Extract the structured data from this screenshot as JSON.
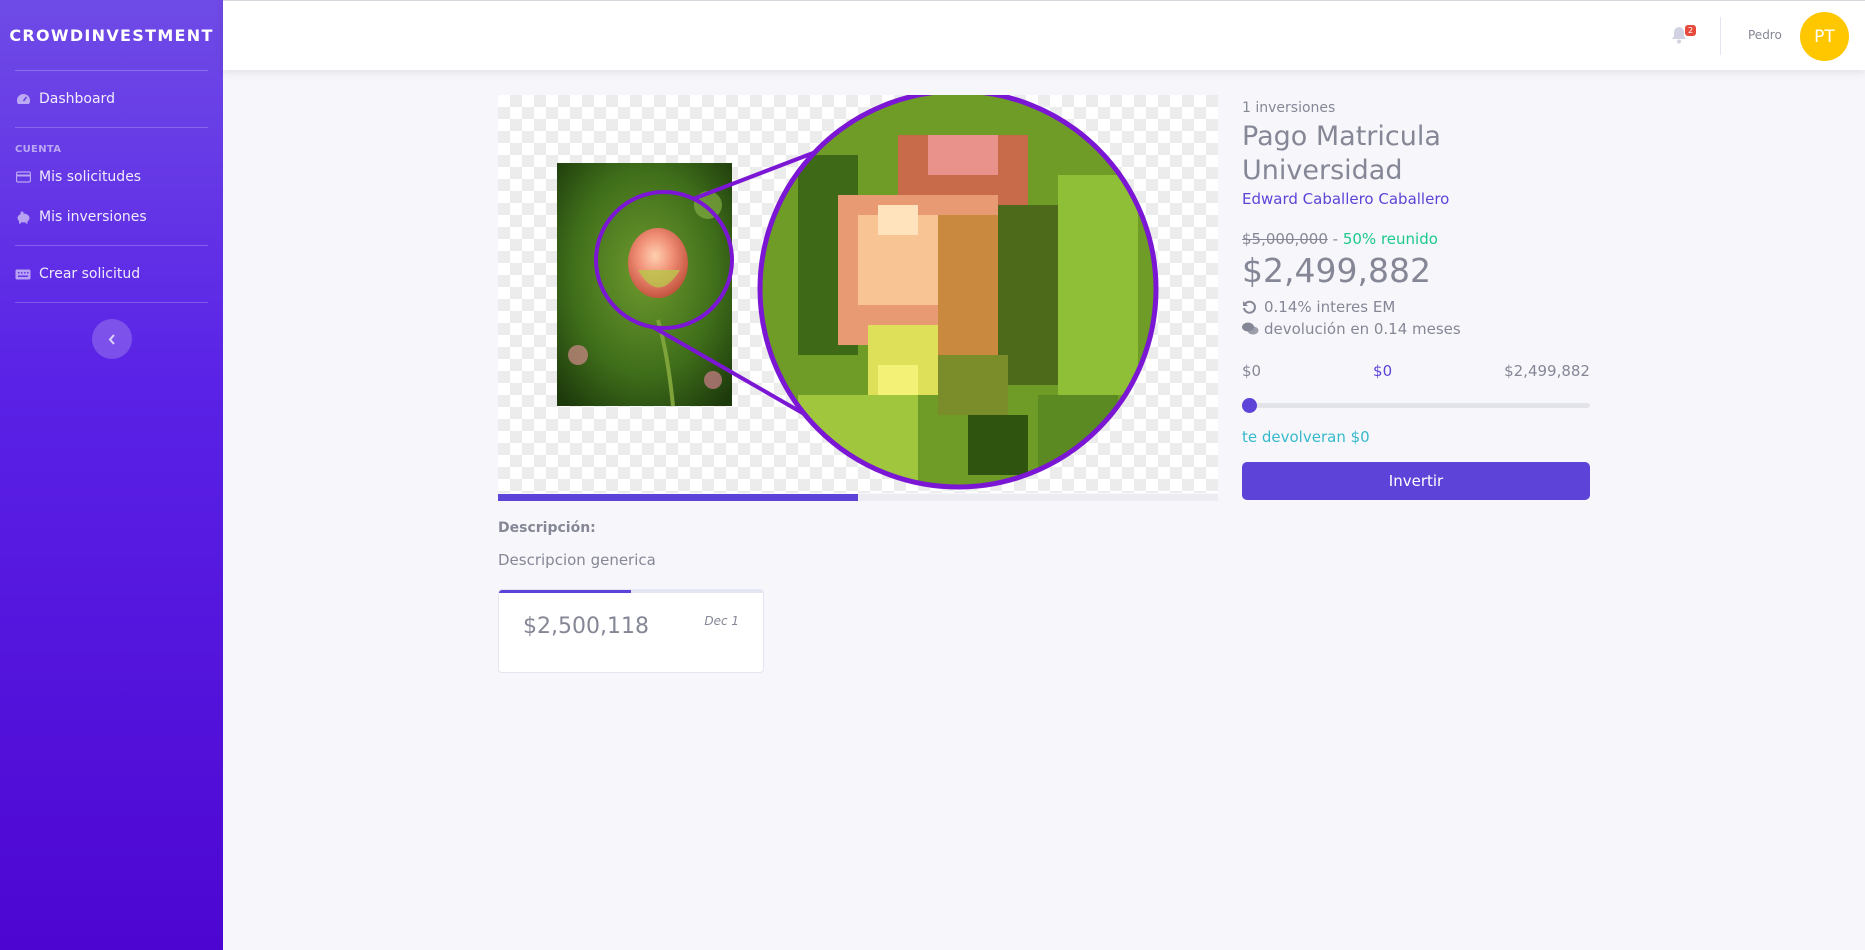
{
  "sidebar": {
    "brand": "CROWDINVESTMENT",
    "dashboard": "Dashboard",
    "section_heading": "CUENTA",
    "items": [
      {
        "label": "Mis solicitudes",
        "icon": "credit-card-icon"
      },
      {
        "label": "Mis inversiones",
        "icon": "piggy-bank-icon"
      },
      {
        "label": "Crear solicitud",
        "icon": "keyboard-icon"
      }
    ],
    "toggle_icon": "chevron-left-icon"
  },
  "topbar": {
    "notification_count": "2",
    "username": "Pedro",
    "avatar_initials": "PT"
  },
  "project": {
    "image_progress_pct": 50,
    "description_label": "Descripción:",
    "description": "Descripcion generica",
    "investment": {
      "amount": "$2,500,118",
      "date": "Dec 1",
      "progress_pct": 50
    },
    "investments_count": "1 inversiones",
    "title": "Pago Matricula Universidad",
    "author": "Edward Caballero Caballero",
    "goal": "$5,000,000",
    "separator": " - ",
    "reached": "50% reunido",
    "remaining": "$2,499,882",
    "interest": "0.14% interes EM",
    "return_period": "devolución en 0.14 meses",
    "range": {
      "min": "$0",
      "current": "$0",
      "max": "$2,499,882",
      "value_fraction": 0
    },
    "return_text": "te devolveran $0",
    "invest_button": "Invertir"
  },
  "colors": {
    "accent": "#5e43d8",
    "success": "#1cc88a",
    "info": "#36b9cc",
    "avatar": "#ffc700",
    "danger": "#e74a3b"
  }
}
